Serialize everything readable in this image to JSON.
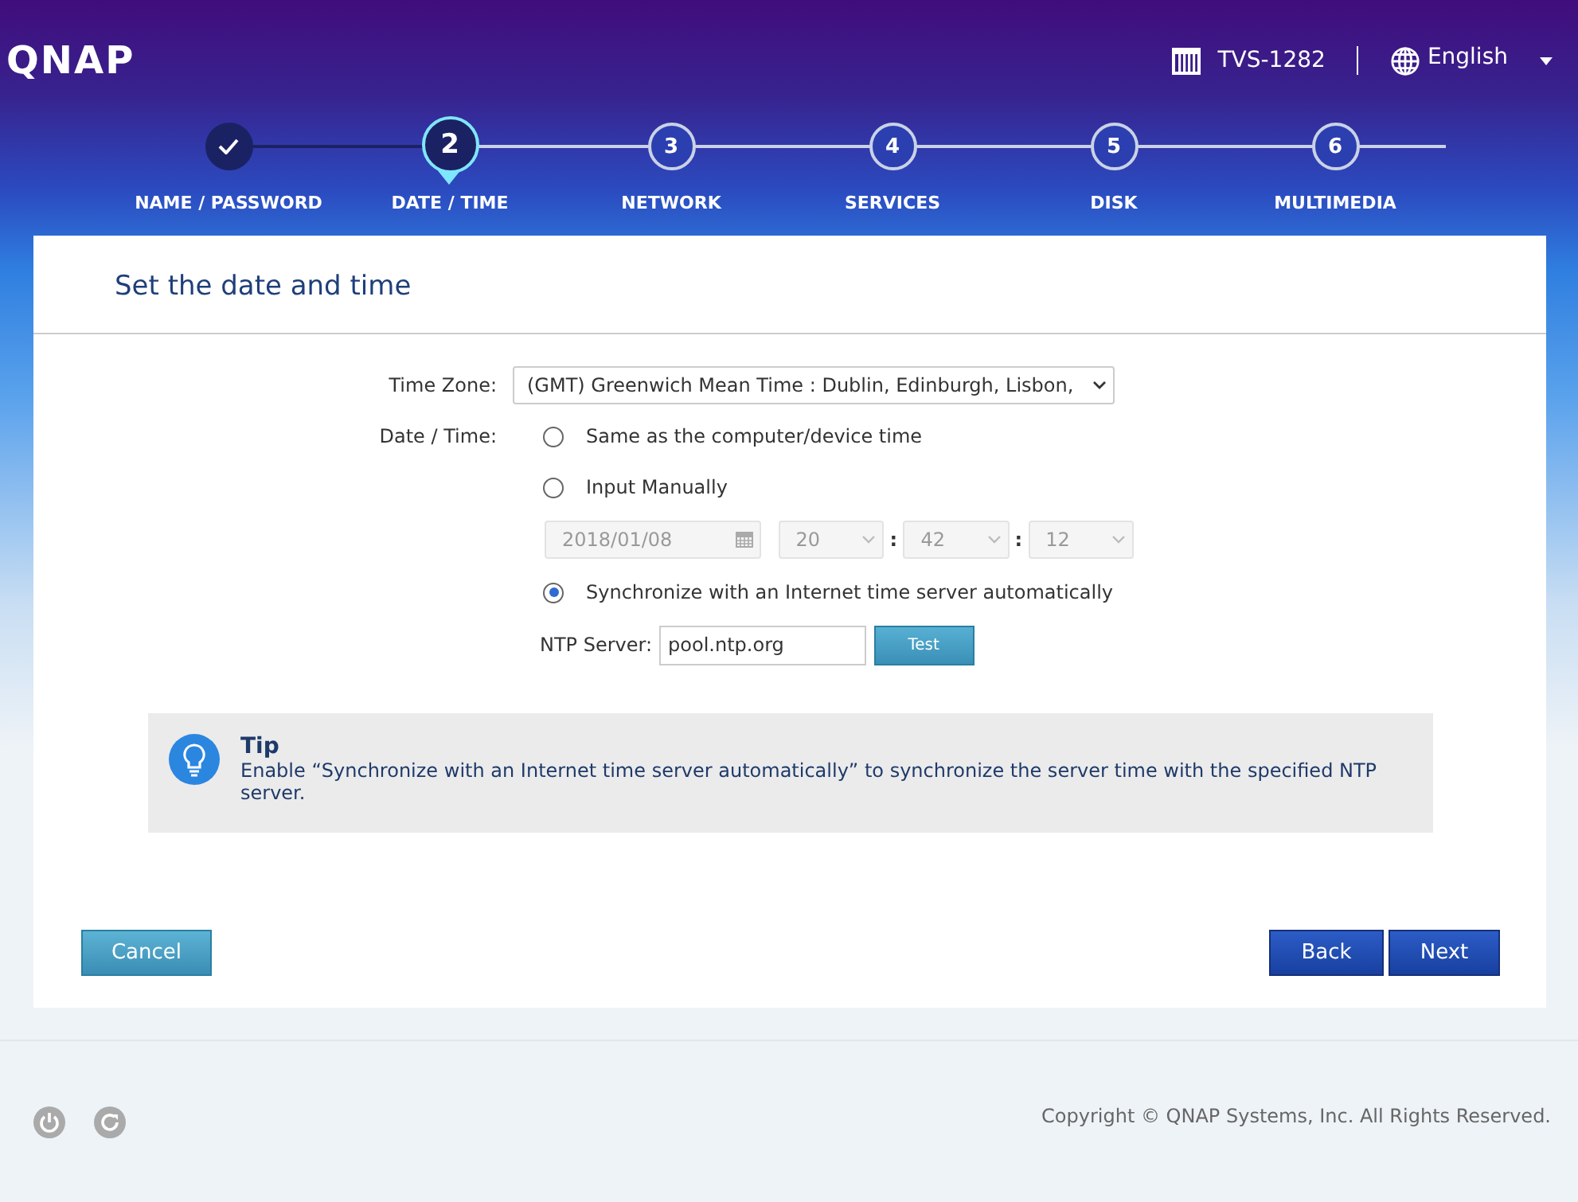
{
  "header": {
    "logo": "QNAP",
    "device": "TVS-1282",
    "language": "English"
  },
  "steps": [
    {
      "label": "NAME / PASSWORD",
      "completed": true,
      "selected": false
    },
    {
      "number": "2",
      "label": "DATE / TIME",
      "completed": false,
      "selected": true
    },
    {
      "number": "3",
      "label": "NETWORK",
      "completed": false,
      "selected": false
    },
    {
      "number": "4",
      "label": "SERVICES",
      "completed": false,
      "selected": false
    },
    {
      "number": "5",
      "label": "DISK",
      "completed": false,
      "selected": false
    },
    {
      "number": "6",
      "label": "MULTIMEDIA",
      "completed": false,
      "selected": false
    }
  ],
  "panel": {
    "title": "Set the date and time",
    "time_zone": {
      "label": "Time Zone:",
      "value": "(GMT) Greenwich Mean Time : Dublin, Edinburgh, Lisbon,"
    },
    "date_time": {
      "label": "Date / Time:",
      "options": [
        {
          "label": "Same as the computer/device time",
          "selected": false
        },
        {
          "label": "Input Manually",
          "selected": false
        },
        {
          "label": "Synchronize with an Internet time server automatically",
          "selected": true
        }
      ],
      "manual": {
        "date": "2018/01/08",
        "hour": "20",
        "minute": "42",
        "second": "12",
        "separator": ":",
        "disabled": true
      },
      "ntp": {
        "label": "NTP Server:",
        "value": "pool.ntp.org",
        "button": "Test"
      }
    },
    "tip": {
      "title": "Tip",
      "text": "Enable “Synchronize with an Internet time server automatically” to synchronize the server time with the specified NTP server."
    },
    "buttons": {
      "cancel": "Cancel",
      "back": "Back",
      "next": "Next"
    }
  },
  "footer": {
    "copyright": "Copyright © QNAP Systems, Inc. All Rights Reserved."
  }
}
